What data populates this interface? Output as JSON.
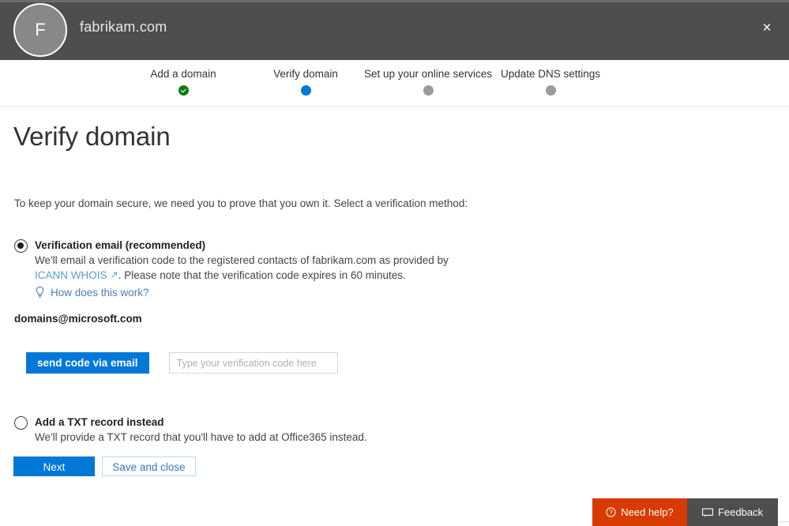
{
  "header": {
    "avatar_initial": "F",
    "domain_title": "fabrikam.com",
    "close_icon": "close-icon",
    "close_glyph": "×",
    "background_color": "#4e4e4e"
  },
  "stepper": {
    "steps": [
      {
        "label": "Add a domain",
        "state": "done",
        "dot_color": "#107c10"
      },
      {
        "label": "Verify domain",
        "state": "current",
        "dot_color": "#0078d7"
      },
      {
        "label": "Set up your online services",
        "state": "todo",
        "dot_color": "#9b9b9b"
      },
      {
        "label": "Update DNS settings",
        "state": "todo",
        "dot_color": "#9b9b9b"
      }
    ]
  },
  "main": {
    "page_title": "Verify domain",
    "intro": "To keep your domain secure, we need you to prove that you own it. Select a verification method:",
    "options": [
      {
        "title": "Verification email (recommended)",
        "selected": true,
        "desc_part1": "We'll email a verification code to the registered contacts of fabrikam.com as provided by ",
        "link_text": "ICANN WHOIS",
        "ext_arrow": "↗",
        "desc_part2": ". Please note that the verification code expires in 60 minutes.",
        "help_icon": "lightbulb-icon",
        "help_link": "How does this work?"
      },
      {
        "title": "Add a TXT record instead",
        "selected": false,
        "desc_part1": "We'll provide a TXT record that you'll have to add at Office365 instead.",
        "link_text": "",
        "ext_arrow": "",
        "desc_part2": ""
      }
    ],
    "email_address": "domains@microsoft.com",
    "send_code_button": "send code via email",
    "code_input_value": "",
    "code_input_placeholder": "Type your verification code here"
  },
  "actions": {
    "next_label": "Next",
    "save_close_label": "Save and close"
  },
  "bottom_bar": {
    "need_help_label": "Need help?",
    "need_help_icon": "question-circle-icon",
    "need_help_color": "#d83b01",
    "feedback_label": "Feedback",
    "feedback_icon": "speech-bubble-icon",
    "feedback_color": "#4e4e4e"
  },
  "colors": {
    "accent_blue": "#0078d7",
    "link_blue": "#5b9bd5",
    "success_green": "#107c10",
    "orange": "#d83b01"
  }
}
